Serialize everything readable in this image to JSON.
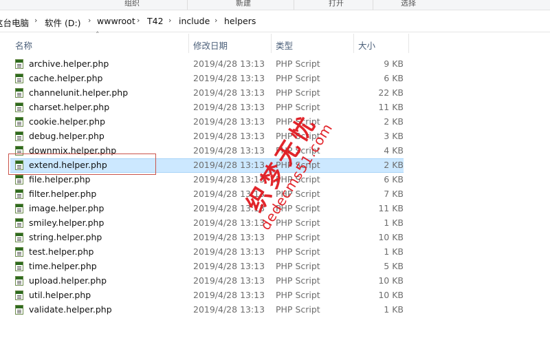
{
  "ribbon": {
    "items": [
      "组织",
      "新建",
      "打开",
      "选择"
    ]
  },
  "breadcrumb": [
    "这台电脑",
    "软件 (D:)",
    "wwwroot",
    "T42",
    "include",
    "helpers"
  ],
  "columns": {
    "name": "名称",
    "date": "修改日期",
    "type": "类型",
    "size": "大小"
  },
  "files": [
    {
      "name": "archive.helper.php",
      "date": "2019/4/28 13:13",
      "type": "PHP Script",
      "size": "9 KB"
    },
    {
      "name": "cache.helper.php",
      "date": "2019/4/28 13:13",
      "type": "PHP Script",
      "size": "6 KB"
    },
    {
      "name": "channelunit.helper.php",
      "date": "2019/4/28 13:13",
      "type": "PHP Script",
      "size": "22 KB"
    },
    {
      "name": "charset.helper.php",
      "date": "2019/4/28 13:13",
      "type": "PHP Script",
      "size": "11 KB"
    },
    {
      "name": "cookie.helper.php",
      "date": "2019/4/28 13:13",
      "type": "PHP Script",
      "size": "2 KB"
    },
    {
      "name": "debug.helper.php",
      "date": "2019/4/28 13:13",
      "type": "PHP Script",
      "size": "3 KB"
    },
    {
      "name": "downmix.helper.php",
      "date": "2019/4/28 13:13",
      "type": "PHP Script",
      "size": "4 KB"
    },
    {
      "name": "extend.helper.php",
      "date": "2019/4/28 13:13",
      "type": "PHP Script",
      "size": "2 KB"
    },
    {
      "name": "file.helper.php",
      "date": "2019/4/28 13:13",
      "type": "PHP Script",
      "size": "6 KB"
    },
    {
      "name": "filter.helper.php",
      "date": "2019/4/28 13:13",
      "type": "PHP Script",
      "size": "7 KB"
    },
    {
      "name": "image.helper.php",
      "date": "2019/4/28 13:13",
      "type": "PHP Script",
      "size": "11 KB"
    },
    {
      "name": "smiley.helper.php",
      "date": "2019/4/28 13:13",
      "type": "PHP Script",
      "size": "1 KB"
    },
    {
      "name": "string.helper.php",
      "date": "2019/4/28 13:13",
      "type": "PHP Script",
      "size": "10 KB"
    },
    {
      "name": "test.helper.php",
      "date": "2019/4/28 13:13",
      "type": "PHP Script",
      "size": "1 KB"
    },
    {
      "name": "time.helper.php",
      "date": "2019/4/28 13:13",
      "type": "PHP Script",
      "size": "5 KB"
    },
    {
      "name": "upload.helper.php",
      "date": "2019/4/28 13:13",
      "type": "PHP Script",
      "size": "10 KB"
    },
    {
      "name": "util.helper.php",
      "date": "2019/4/28 13:13",
      "type": "PHP Script",
      "size": "10 KB"
    },
    {
      "name": "validate.helper.php",
      "date": "2019/4/28 13:13",
      "type": "PHP Script",
      "size": "1 KB"
    }
  ],
  "selected_index": 7,
  "watermark": {
    "text": "织梦无忧",
    "url": "dedecms51.com",
    "color": "#e0141b"
  }
}
